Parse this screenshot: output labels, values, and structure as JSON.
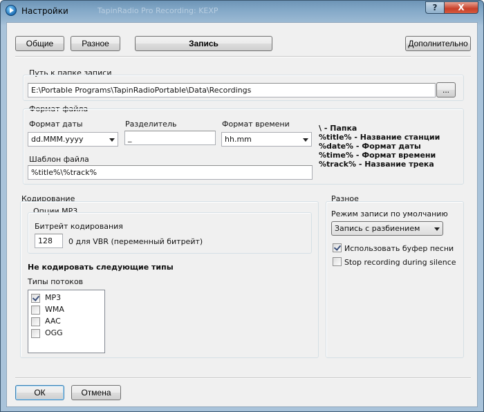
{
  "window": {
    "title": "Настройки",
    "background_title": "TapinRadio Pro    Recording: KEXP",
    "help_label": "?",
    "close_label": "X"
  },
  "tabs": {
    "general": "Общие",
    "misc": "Разное",
    "record": "Запись",
    "advanced": "Дополнительно"
  },
  "path": {
    "label": "Путь к папке записи",
    "value": "E:\\Portable Programs\\TapinRadioPortable\\Data\\Recordings",
    "browse_label": "..."
  },
  "file_format": {
    "group_label": "Формат файла",
    "date_label": "Формат даты",
    "date_value": "dd.MMM.yyyy",
    "separator_label": "Разделитель",
    "separator_value": "_",
    "time_label": "Формат времени",
    "time_value": "hh.mm",
    "template_label": "Шаблон файла",
    "template_value": "%title%\\%track%",
    "help": [
      "\\ - Папка",
      "%title% - Название станции",
      "%date% - Формат даты",
      "%time% - Формат времени",
      "%track% - Название трека"
    ]
  },
  "encoding": {
    "group_label": "Кодирование",
    "mp3_label": "Опции MP3",
    "bitrate_label": "Битрейт кодирования",
    "bitrate_value": "128",
    "bitrate_hint": "0 для VBR (переменный битрейт)",
    "no_encode_label": "Не кодировать следующие типы",
    "stream_types_label": "Типы потоков",
    "stream_types": [
      {
        "label": "MP3",
        "checked": true
      },
      {
        "label": "WMA",
        "checked": false
      },
      {
        "label": "AAC",
        "checked": false
      },
      {
        "label": "OGG",
        "checked": false
      }
    ]
  },
  "misc": {
    "group_label": "Разное",
    "mode_label": "Режим записи по умолчанию",
    "mode_value": "Запись с разбиением",
    "use_buffer_label": "Использовать буфер песни",
    "use_buffer_checked": true,
    "stop_silence_label": "Stop recording during silence",
    "stop_silence_checked": false
  },
  "footer": {
    "ok_label": "ОК",
    "cancel_label": "Отмена"
  }
}
